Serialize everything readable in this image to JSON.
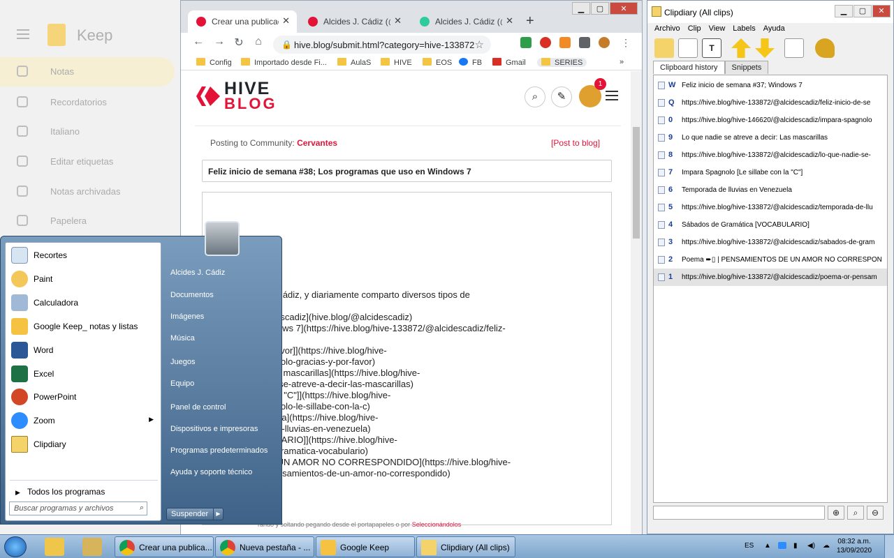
{
  "keep": {
    "title": "Keep",
    "nav": [
      "Notas",
      "Recordatorios",
      "Italiano",
      "Editar etiquetas",
      "Notas archivadas",
      "Papelera"
    ]
  },
  "browser": {
    "tabs": [
      {
        "title": "Crear una publicació",
        "color": "#e31337",
        "active": true
      },
      {
        "title": "Alcides J. Cádiz (@alc",
        "color": "#e31337",
        "active": false
      },
      {
        "title": "Alcides J. Cádiz (@alc",
        "color": "#2ecc9a",
        "active": false
      }
    ],
    "url": "hive.blog/submit.html?category=hive-133872",
    "bookmarks": [
      "Config",
      "Importado desde Fi...",
      "AulaS",
      "HIVE",
      "EOS",
      "FB",
      "Gmail",
      "SERIES"
    ],
    "page": {
      "logo_top": "HIVE",
      "logo_bottom": "BLOG",
      "notification_count": "1",
      "posting_label": "Posting to Community:",
      "community": "Cervantes",
      "post_to_blog": "[Post to blog]",
      "post_title": "Feliz inicio de semana #38;  Los programas que uso en Windows 7",
      "body_lines": [
        "e mi, soy Alcides Cádiz, y diariamente comparto diversos tipos de",
        "",
        "[hive.blog/@alcidescadiz](hive.blog/@alcidescadiz)",
        "emana #37; Windows 7](https://hive.blog/hive-133872/@alcidescadiz/feliz-",
        "37-windows-7)",
        "o [Gracias y por favor]](https://hive.blog/hive-",
        "adiz/impara-spagnolo-gracias-y-por-favor)",
        "atreve a decir: Las mascarillas](https://hive.blog/hive-",
        "adiz/lo-que-nadie-se-atreve-a-decir-las-mascarillas)",
        "o [Le sillabe con la \"C\"]](https://hive.blog/hive-",
        "adiz/impara-spagnolo-le-sillabe-con-la-c)",
        "luvias en Venezuela](https://hive.blog/hive-",
        "adiz/temporada-de-lluvias-en-venezuela)",
        "mática [VOCABULARIO]](https://hive.blog/hive-",
        "adiz/sabados-de-gramatica-vocabulario)",
        "SAMIENTOS DE UN AMOR NO CORRESPONDIDO](https://hive.blog/hive-",
        "adiz/poema-or-pensamientos-de-un-amor-no-correspondido)"
      ],
      "footer_note": "rando y soltando pegando desde el portapapeles o por",
      "footer_link": "Seleccionándolos"
    }
  },
  "start_menu": {
    "programs": [
      "Recortes",
      "Paint",
      "Calculadora",
      "Google Keep_ notas y listas",
      "Word",
      "Excel",
      "PowerPoint",
      "Zoom",
      "Clipdiary"
    ],
    "all_programs": "Todos los programas",
    "search_placeholder": "Buscar programas y archivos",
    "right_items": [
      "Alcides J. Cádiz",
      "Documentos",
      "Imágenes",
      "Música",
      "Juegos",
      "Equipo",
      "Panel de control",
      "Dispositivos e impresoras",
      "Programas predeterminados",
      "Ayuda y soporte técnico"
    ],
    "suspend": "Suspender"
  },
  "clipdiary": {
    "title": "Clipdiary (All clips)",
    "menu": [
      "Archivo",
      "Clip",
      "View",
      "Labels",
      "Ayuda"
    ],
    "tabs": [
      "Clipboard history",
      "Snippets"
    ],
    "clips": [
      {
        "num": "W",
        "text": "Feliz inicio de semana #37; Windows 7"
      },
      {
        "num": "Q",
        "text": "https://hive.blog/hive-133872/@alcidescadiz/feliz-inicio-de-se"
      },
      {
        "num": "0",
        "text": "https://hive.blog/hive-146620/@alcidescadiz/impara-spagnolo"
      },
      {
        "num": "9",
        "text": "Lo que nadie se atreve a decir: Las mascarillas"
      },
      {
        "num": "8",
        "text": "https://hive.blog/hive-133872/@alcidescadiz/lo-que-nadie-se-"
      },
      {
        "num": "7",
        "text": "Impara Spagnolo [Le sillabe con la \"C\"]"
      },
      {
        "num": "6",
        "text": "  Temporada de lluvias en Venezuela"
      },
      {
        "num": "5",
        "text": "https://hive.blog/hive-133872/@alcidescadiz/temporada-de-llu"
      },
      {
        "num": "4",
        "text": "Sábados de Gramática [VOCABULARIO]"
      },
      {
        "num": "3",
        "text": "https://hive.blog/hive-133872/@alcidescadiz/sabados-de-gram"
      },
      {
        "num": "2",
        "text": "  Poema ➨▯ | PENSAMIENTOS DE UN AMOR NO CORRESPON"
      },
      {
        "num": "1",
        "text": "https://hive.blog/hive-133872/@alcidescadiz/poema-or-pensam"
      }
    ]
  },
  "taskbar": {
    "tasks": [
      "Crear una publica...",
      "Nueva pestaña - ...",
      "Google Keep",
      "Clipdiary (All clips)"
    ],
    "language": "ES",
    "time": "08:32 a.m.",
    "date": "13/09/2020"
  }
}
